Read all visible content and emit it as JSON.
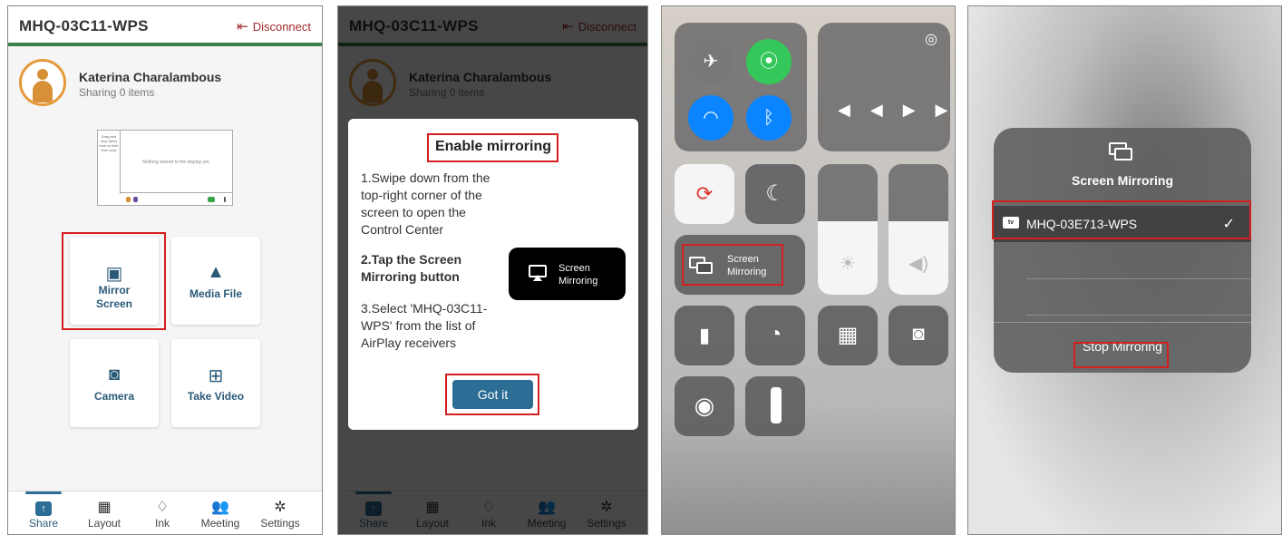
{
  "app": {
    "title": "MHQ-03C11-WPS",
    "disconnect": "Disconnect",
    "user_name": "Katerina Charalambous",
    "user_status": "Sharing 0 items",
    "preview": {
      "side_text": "Drag and drop items here to hide from view",
      "main_text": "Nothing shared to the display yet."
    },
    "tiles": {
      "mirror": [
        "Mirror",
        "Screen"
      ],
      "media": "Media File",
      "camera": "Camera",
      "video": "Take Video"
    },
    "tabs": [
      "Share",
      "Layout",
      "Ink",
      "Meeting",
      "Settings"
    ]
  },
  "modal": {
    "title": "Enable mirroring",
    "step1": "1.Swipe down from the top-right corner of the screen to open the Control Center",
    "step2": "2.Tap the Screen Mirroring button",
    "step3": "3.Select 'MHQ-03C11-WPS' from the list of AirPlay receivers",
    "button_label": [
      "Screen",
      "Mirroring"
    ],
    "got_it": "Got it"
  },
  "control_center": {
    "screen_mirroring": [
      "Screen",
      "Mirroring"
    ]
  },
  "mirroring_menu": {
    "title": "Screen Mirroring",
    "tv_badge": "tv",
    "device": "MHQ-03E713-WPS",
    "stop": "Stop Mirroring"
  },
  "colors": {
    "accent": "#2b6d94",
    "header_rule": "#3d7f4e",
    "disconnect": "#a32a2a",
    "highlight": "#d41f1f",
    "cc_green": "#34c759",
    "cc_blue": "#0a84ff"
  }
}
